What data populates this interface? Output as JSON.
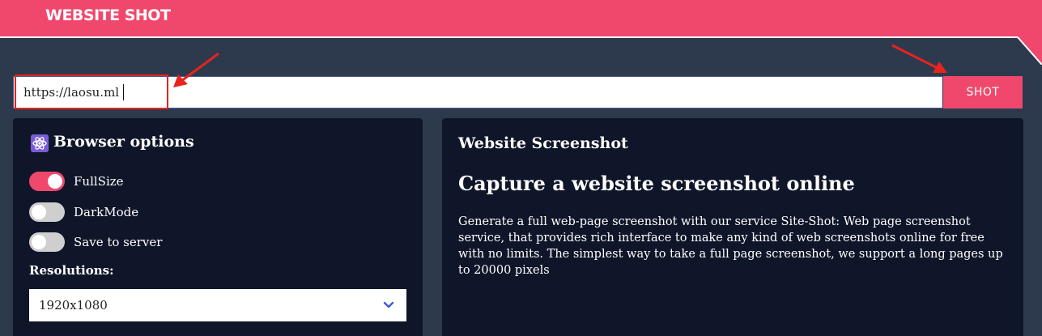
{
  "header": {
    "logo_text": "WEBSITE SHOT"
  },
  "toolbar": {
    "url_value": "https://laosu.ml",
    "shot_label": "SHOT"
  },
  "browser_options": {
    "title": "Browser options",
    "icon": "atom-icon",
    "options": [
      {
        "label": "FullSize",
        "enabled": true
      },
      {
        "label": "DarkMode",
        "enabled": false
      },
      {
        "label": "Save to server",
        "enabled": false
      }
    ],
    "resolutions_label": "Resolutions:",
    "resolution_selected": "1920x1080"
  },
  "info": {
    "subtitle": "Website Screenshot",
    "heading": "Capture a website screenshot online",
    "description": "Generate a full web-page screenshot with our service Site-Shot: Web page screenshot service, that provides rich interface to make any kind of web screenshots online for free with no limits. The simplest way to take a full page screenshot, we support a long pages up to 20000 pixels"
  },
  "colors": {
    "accent": "#f0486c",
    "background": "#2d3a4e",
    "panel": "#0f1629",
    "annotation": "#e8231c"
  }
}
